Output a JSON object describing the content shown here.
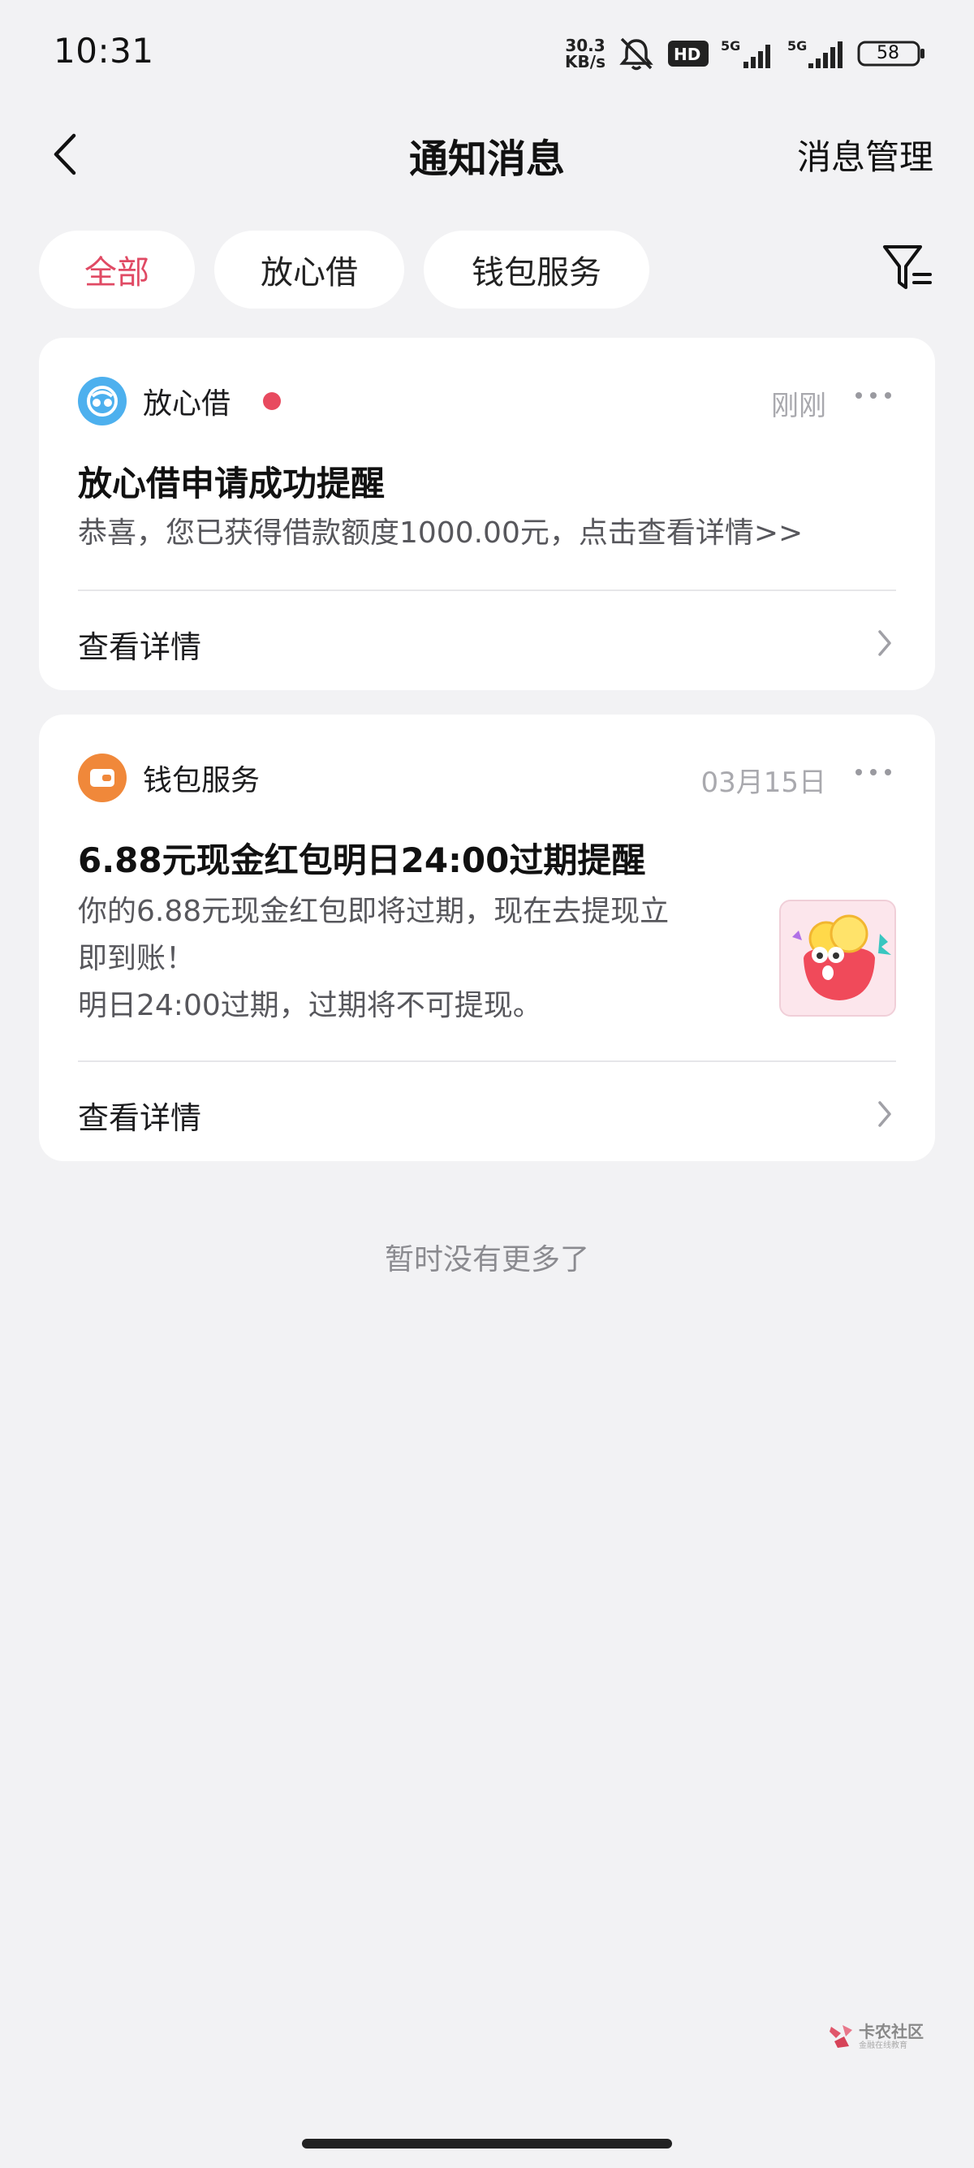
{
  "status_bar": {
    "time": "10:31",
    "net_speed_value": "30.3",
    "net_speed_unit": "KB/s",
    "hd_label": "HD",
    "sig1_label": "5G",
    "sig2_label": "5G",
    "battery": "58"
  },
  "header": {
    "title": "通知消息",
    "manage_label": "消息管理",
    "back_icon": "chevron-left-icon"
  },
  "tabs": [
    {
      "label": "全部",
      "active": true
    },
    {
      "label": "放心借",
      "active": false
    },
    {
      "label": "钱包服务",
      "active": false
    }
  ],
  "filter_icon": "filter-icon",
  "messages": [
    {
      "app": "放心借",
      "icon": "fangxinjie-logo-icon",
      "icon_color": "#4db0ee",
      "unread": true,
      "time": "刚刚",
      "title": "放心借申请成功提醒",
      "body": "恭喜，您已获得借款额度1000.00元，点击查看详情>>",
      "detail_label": "查看详情"
    },
    {
      "app": "钱包服务",
      "icon": "wallet-icon",
      "icon_color": "#f0883a",
      "unread": false,
      "time": "03月15日",
      "title": "6.88元现金红包明日24:00过期提醒",
      "body_line1": "你的6.88元现金红包即将过期，现在去提现立",
      "body_line2": "即到账！",
      "body_line3": "明日24:00过期，过期将不可提现。",
      "detail_label": "查看详情",
      "thumbnail": "red-packet-pig-illustration"
    }
  ],
  "footer_text": "暂时没有更多了",
  "watermark": {
    "title": "卡农社区",
    "subtitle": "金融在线教育"
  },
  "colors": {
    "accent": "#e04a64",
    "background": "#f2f2f4",
    "card": "#ffffff",
    "muted_text": "#a9a9ae"
  }
}
